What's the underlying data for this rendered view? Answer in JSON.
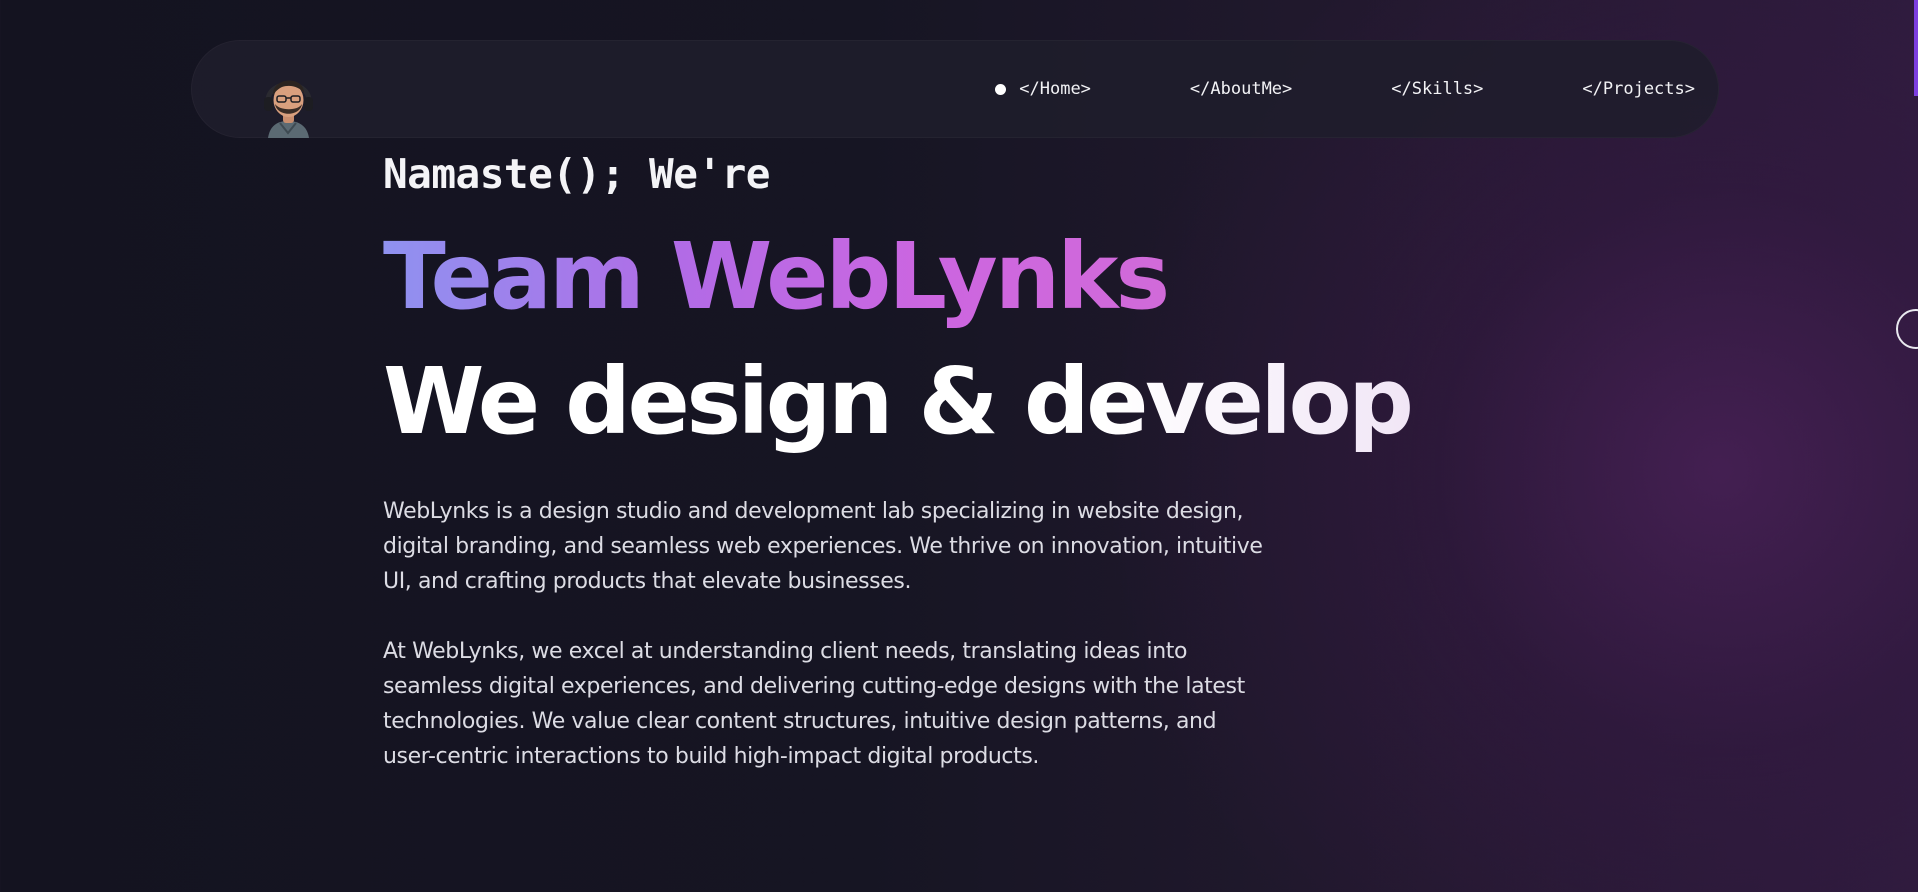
{
  "navbar": {
    "avatar_alt_icon": "memoji-avatar-icon",
    "items": [
      {
        "label": "</Home>",
        "active": true
      },
      {
        "label": "</AboutMe>",
        "active": false
      },
      {
        "label": "</Skills>",
        "active": false
      },
      {
        "label": "</Projects>",
        "active": false
      }
    ]
  },
  "hero": {
    "greeting": "Namaste(); We're",
    "brand": "Team WebLynks",
    "tagline": "We design & develop",
    "paragraphs": [
      "WebLynks is a design studio and development lab specializing in website design, digital branding, and seamless web experiences. We thrive on innovation, intuitive UI, and crafting products that elevate businesses.",
      "At WebLynks, we excel at understanding client needs, translating ideas into seamless digital experiences, and delivering cutting-edge designs with the latest technologies. We value clear content structures, intuitive design patterns, and user-centric interactions to build high-impact digital products."
    ]
  },
  "colors": {
    "background": "#141320",
    "accent_violet": "#7d3fe0",
    "brand_gradient_start": "#8f92f0",
    "brand_gradient_end": "#d16ad9"
  }
}
